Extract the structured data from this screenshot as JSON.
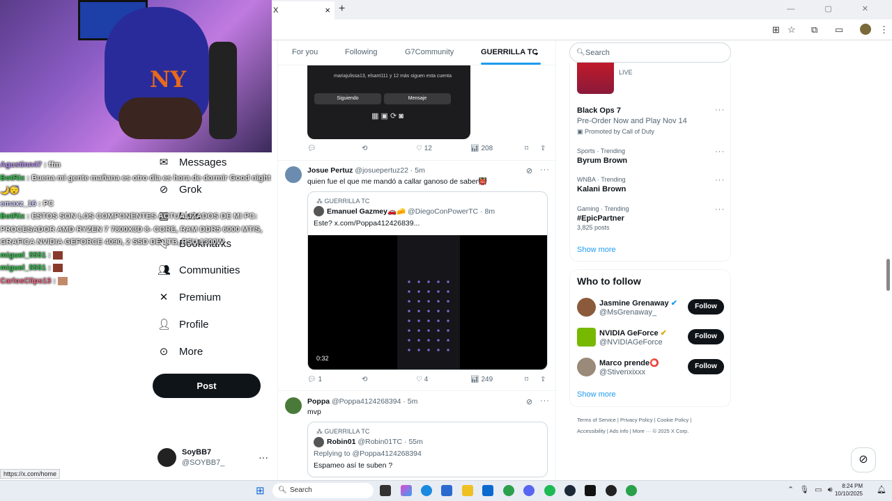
{
  "browser": {
    "tab_title": "X",
    "tab_close": "×",
    "new_tab": "+",
    "window_controls": "— ▢ ✕",
    "status_url": "https://x.com/home"
  },
  "chat": [
    {
      "user": "Agustinn47",
      "msg": " : ffm",
      "class": "u1"
    },
    {
      "user": "BotRix",
      "msg": " : Buena mi gente mañana es otro día es hora de dormir Good night",
      "class": "u2",
      "extra": "🌙😴"
    },
    {
      "user": "emaxz_16",
      "msg": " : PC",
      "class": "u3"
    },
    {
      "user": "BotRix",
      "msg": " : ESTOS SON LOS COMPONENTES ACTUALIZADOS DE MI PC: PROCESADOR AMD RYZEN 7 7800X3D 8- CORE, RAM DDR5 6000 MT/S, GRAFICA NVIDIA GEFORCE 4090, 2 SSD DE 1TB, PSU 1300W",
      "class": "u2"
    },
    {
      "user": "miguel_5551",
      "msg": " : ",
      "class": "u2"
    },
    {
      "user": "miguel_5551",
      "msg": " : ",
      "class": "u2"
    },
    {
      "user": "CarlosClips13",
      "msg": " : ",
      "class": "u4"
    }
  ],
  "nav": {
    "messages": "Messages",
    "grok": "Grok",
    "lists": "Lists",
    "bookmarks": "Bookmarks",
    "communities": "Communities",
    "premium": "Premium",
    "profile": "Profile",
    "more": "More",
    "post": "Post"
  },
  "account": {
    "name": "SoyBB7",
    "handle": "@SOYBB7_",
    "dots": "···"
  },
  "feed_tabs": [
    "For you",
    "Following",
    "G7Community",
    "GUERRILLA TC"
  ],
  "tweets": [
    {
      "partial_text_1": "mariajulissa13, elsant111 y 12 más siguen esta cuenta",
      "btn_following": "Siguiendo",
      "btn_message": "Mensaje",
      "replies": "",
      "likes": "12",
      "views": "208"
    },
    {
      "name": "Josue Pertuz",
      "handle": "@josuepertuz22 · 5m",
      "text": "quien fue el que me mandó a callar ganoso de saber👹",
      "quote_community": "GUERRILLA TC",
      "quote_name": "Emanuel Gazmey🚗🧀",
      "quote_handle": "@DiegoConPowerTC · 8m",
      "quote_text": "Este? x.com/Poppa412426839...",
      "video_time": "0:32",
      "replies": "1",
      "likes": "4",
      "views": "249"
    },
    {
      "name": "Poppa",
      "handle": "@Poppa4124268394 · 5m",
      "text": "mvp",
      "quote_community": "GUERRILLA TC",
      "quote_name": "Robin01",
      "quote_handle": "@Robin01TC · 55m",
      "replying": "Replying to @Poppa4124268394",
      "quote_text": "Espameo así te suben ?"
    }
  ],
  "search": {
    "placeholder": "Search"
  },
  "trends": {
    "event_meta": "LIVE",
    "ad_title": "Black Ops 7",
    "ad_sub": "Pre-Order Now and Play Nov 14",
    "ad_promo": "Promoted by Call of Duty",
    "items": [
      {
        "meta": "Sports · Trending",
        "title": "Byrum Brown",
        "posts": ""
      },
      {
        "meta": "WNBA · Trending",
        "title": "Kalani Brown",
        "posts": ""
      },
      {
        "meta": "Gaming · Trending",
        "title": "#EpicPartner",
        "posts": "3,825 posts"
      }
    ],
    "show_more": "Show more"
  },
  "who_to_follow": {
    "title": "Who to follow",
    "follow_label": "Follow",
    "users": [
      {
        "name": "Jasmine Grenaway",
        "handle": "@MsGrenaway_"
      },
      {
        "name": "NVIDIA GeForce",
        "handle": "@NVIDIAGeForce"
      },
      {
        "name": "Marco prende⭕",
        "handle": "@Stivenxixxx"
      }
    ],
    "show_more": "Show more"
  },
  "footer": {
    "line1": "Terms of Service  |  Privacy Policy  |  Cookie Policy  |",
    "line2": "Accessibility  |  Ads info  |  More ···  © 2025 X Corp."
  },
  "taskbar": {
    "search": "Search",
    "time": "8:24 PM",
    "date": "10/10/2025"
  }
}
